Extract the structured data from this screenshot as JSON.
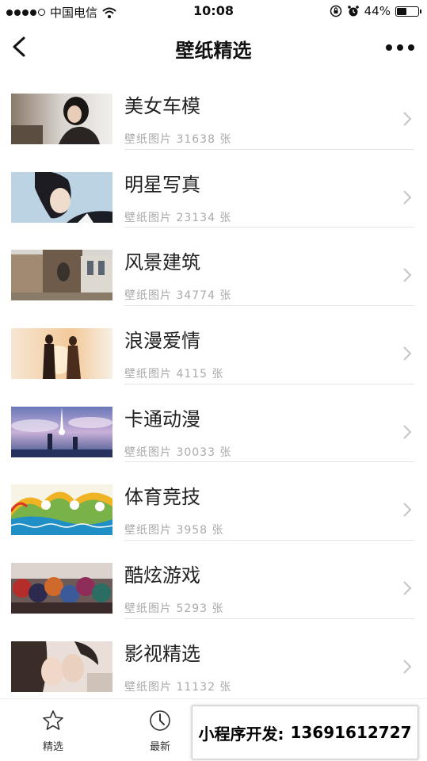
{
  "status_bar": {
    "carrier": "中国电信",
    "time": "10:08",
    "battery_percent": "44%",
    "battery_level": 0.44
  },
  "nav": {
    "title": "壁纸精选"
  },
  "categories": [
    {
      "title": "美女车模",
      "subtitle": "壁纸图片 31638 张"
    },
    {
      "title": "明星写真",
      "subtitle": "壁纸图片 23134 张"
    },
    {
      "title": "风景建筑",
      "subtitle": "壁纸图片 34774 张"
    },
    {
      "title": "浪漫爱情",
      "subtitle": "壁纸图片 4115 张"
    },
    {
      "title": "卡通动漫",
      "subtitle": "壁纸图片 30033 张"
    },
    {
      "title": "体育竞技",
      "subtitle": "壁纸图片 3958 张"
    },
    {
      "title": "酷炫游戏",
      "subtitle": "壁纸图片 5293 张"
    },
    {
      "title": "影视精选",
      "subtitle": "壁纸图片 11132 张"
    }
  ],
  "tabs": [
    {
      "label": "精选",
      "icon": "star-icon"
    },
    {
      "label": "最新",
      "icon": "clock-icon"
    }
  ],
  "promo": {
    "label": "小程序开发:",
    "phone": "13691612727"
  }
}
